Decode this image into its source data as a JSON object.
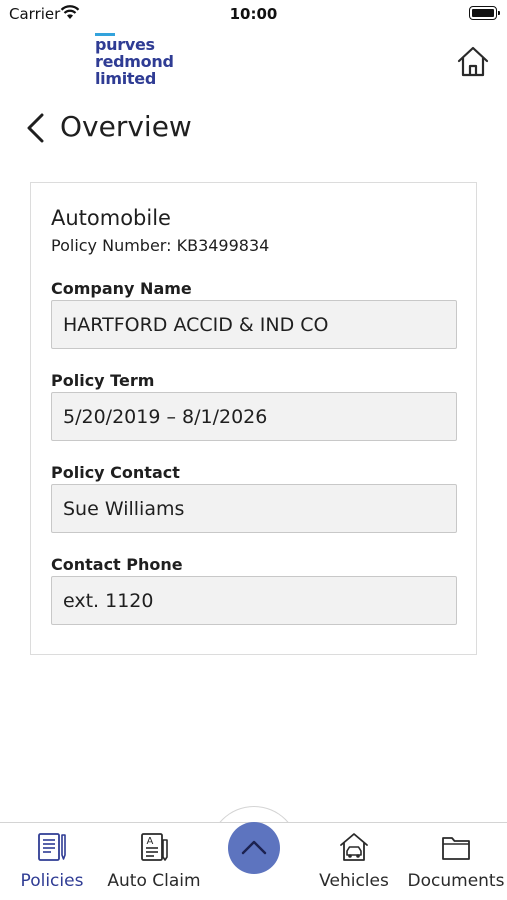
{
  "status_bar": {
    "carrier": "Carrier",
    "time": "10:00"
  },
  "header": {
    "logo_lines": [
      "purves",
      "redmond",
      "limited"
    ],
    "brand_color": "#2f3c94",
    "home_icon": "home-icon"
  },
  "page": {
    "title": "Overview",
    "back_icon": "chevron-left-icon"
  },
  "policy": {
    "type": "Automobile",
    "number_label": "Policy Number:",
    "number": "KB3499834",
    "fields": [
      {
        "label": "Company Name",
        "value": "HARTFORD ACCID & IND CO"
      },
      {
        "label": "Policy Term",
        "value": "5/20/2019 – 8/1/2026"
      },
      {
        "label": "Policy Contact",
        "value": "Sue Williams"
      },
      {
        "label": "Contact Phone",
        "value": "ext. 1120"
      }
    ]
  },
  "tab_bar": {
    "active": "Policies",
    "active_color": "#2f3c94",
    "fab_color": "#5d74bf",
    "fab_icon": "chevron-up-icon",
    "tabs": [
      {
        "label": "Policies",
        "icon": "policies-icon"
      },
      {
        "label": "Auto Claim",
        "icon": "auto-claim-icon"
      },
      {
        "label": "Vehicles",
        "icon": "vehicles-icon"
      },
      {
        "label": "Documents",
        "icon": "documents-icon"
      }
    ]
  }
}
